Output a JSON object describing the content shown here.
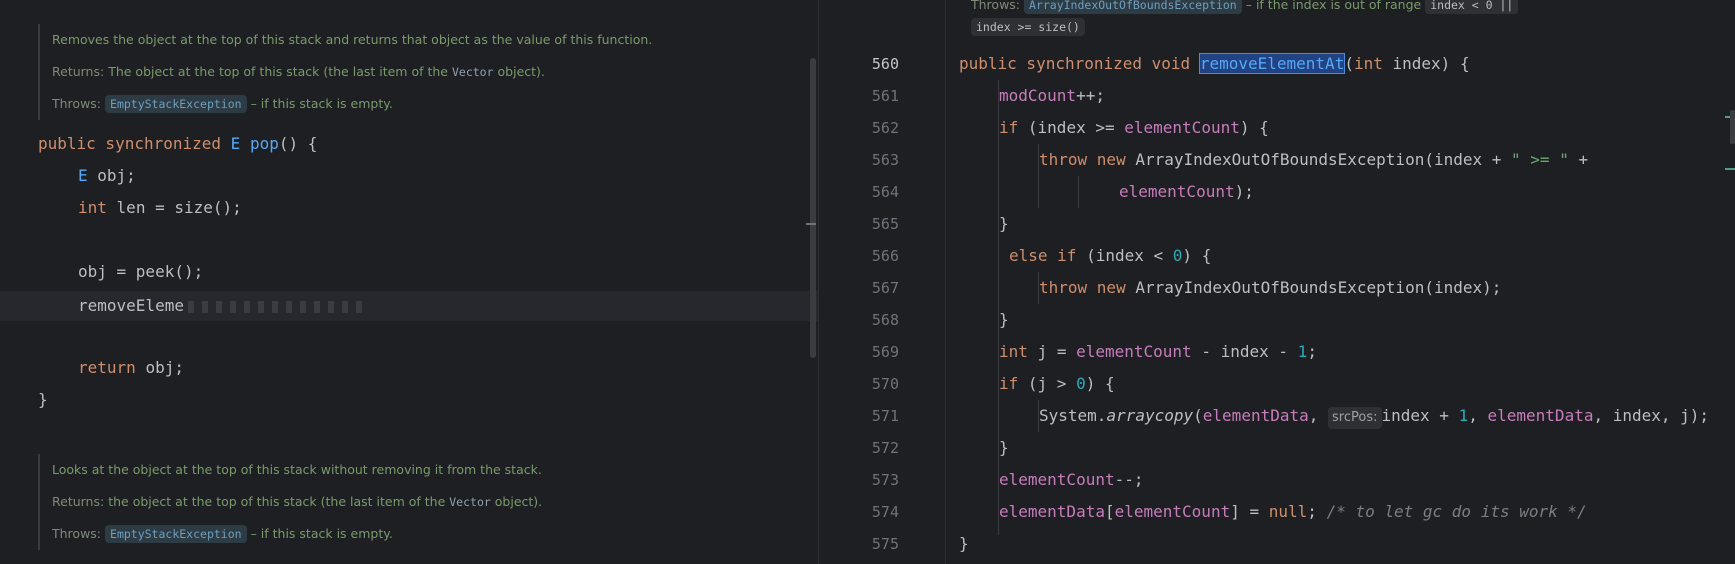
{
  "left": {
    "doc1": {
      "line1": "Removes the object at the top of this stack and returns that object as the value of this function.",
      "returns_label": "Returns:",
      "returns_text_a": "The object at the top of this stack (the last item of the",
      "returns_code": "Vector",
      "returns_text_b": "object).",
      "throws_label": "Throws:",
      "throws_exception": "EmptyStackException",
      "throws_text": "– if this stack is empty."
    },
    "code": {
      "l1_kw": "public synchronized",
      "l1_type": "E",
      "l1_fn": "pop",
      "l1_rest": "() {",
      "l2_type": "E",
      "l2_rest": "obj;",
      "l3_kw": "int",
      "l3_rest": "len = size();",
      "l5": "obj = peek();",
      "l6": "removeEleme",
      "l8_kw": "return",
      "l8_rest": "obj;",
      "l9": "}"
    },
    "doc2": {
      "line1": "Looks at the object at the top of this stack without removing it from the stack.",
      "returns_label": "Returns:",
      "returns_text_a": "the object at the top of this stack (the last item of the",
      "returns_code": "Vector",
      "returns_text_b": "object).",
      "throws_label": "Throws:",
      "throws_exception": "EmptyStackException",
      "throws_text": "– if this stack is empty."
    }
  },
  "right": {
    "top_doc": {
      "throws_label": "Throws:",
      "exception": "ArrayIndexOutOfBoundsException",
      "text": "– if the index is out of range",
      "cond1": "index < 0 ||",
      "cond2": "index >= size()"
    },
    "line_numbers": [
      "560",
      "561",
      "562",
      "563",
      "564",
      "565",
      "566",
      "567",
      "568",
      "569",
      "570",
      "571",
      "572",
      "573",
      "574",
      "575"
    ],
    "code": {
      "l560_kw": "public synchronized void",
      "l560_fn": "removeElementAt",
      "l560_open": "(",
      "l560_kw2": "int",
      "l560_rest": "index) {",
      "l561_fld": "modCount",
      "l561_rest": "++;",
      "l562_kw": "if",
      "l562_a": "(index >=",
      "l562_fld": "elementCount",
      "l562_b": ") {",
      "l563_kw": "throw new",
      "l563_a": "ArrayIndexOutOfBoundsException(index +",
      "l563_str": "\" >= \"",
      "l563_b": "+",
      "l564_fld": "elementCount",
      "l564_rest": ");",
      "l565": "}",
      "l566_kw": "else if",
      "l566_a": "(index <",
      "l566_num": "0",
      "l566_b": ") {",
      "l567_kw": "throw new",
      "l567_rest": "ArrayIndexOutOfBoundsException(index);",
      "l568": "}",
      "l569_kw": "int",
      "l569_a": "j =",
      "l569_fld": "elementCount",
      "l569_b": "- index -",
      "l569_num": "1",
      "l569_c": ";",
      "l570_kw": "if",
      "l570_a": "(j >",
      "l570_num": "0",
      "l570_b": ") {",
      "l571_a": "System.",
      "l571_fn": "arraycopy",
      "l571_b": "(",
      "l571_fld": "elementData",
      "l571_c": ",",
      "l571_hint": "srcPos:",
      "l571_d": "index +",
      "l571_num": "1",
      "l571_e": ",",
      "l571_fld2": "elementData",
      "l571_f": ", index, j);",
      "l572": "}",
      "l573_fld": "elementCount",
      "l573_rest": "--;",
      "l574_fld": "elementData",
      "l574_a": "[",
      "l574_fld2": "elementCount",
      "l574_b": "] =",
      "l574_kw": "null",
      "l574_c": ";",
      "l574_cmt": "/* to let gc do its work */",
      "l575": "}"
    }
  }
}
